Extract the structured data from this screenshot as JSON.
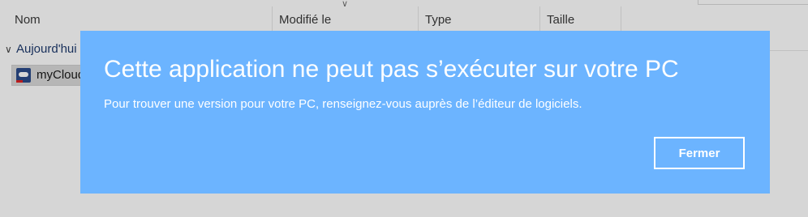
{
  "explorer": {
    "columns": {
      "name": "Nom",
      "modified": "Modifié le",
      "type": "Type",
      "size": "Taille"
    },
    "group_label": "Aujourd'hui",
    "file_name": "myCloud"
  },
  "dialog": {
    "title": "Cette application ne peut pas s’exécuter sur votre PC",
    "message": "Pour trouver une version pour votre PC, renseignez-vous auprès de l’éditeur de logiciels.",
    "close_label": "Fermer",
    "background_color": "#6cb4ff"
  }
}
